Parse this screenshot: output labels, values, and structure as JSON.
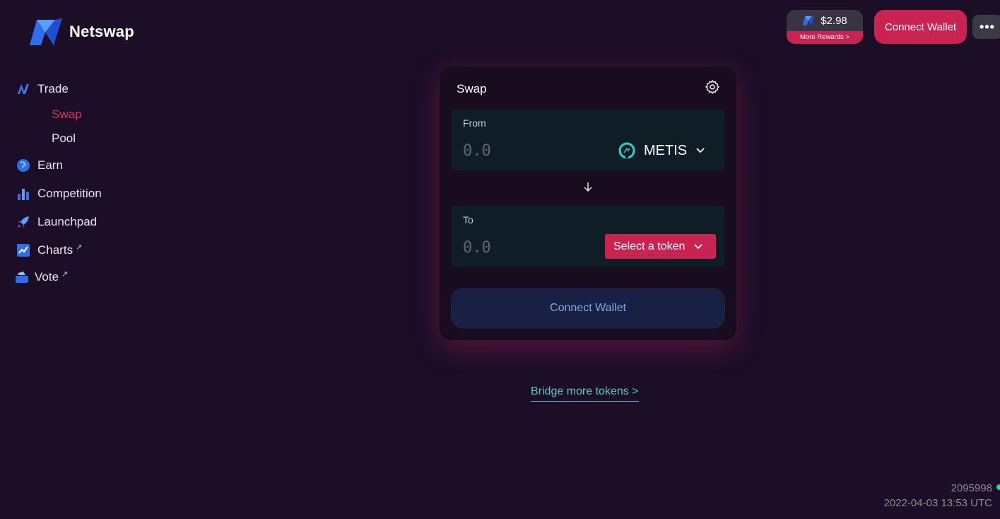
{
  "app": {
    "name": "Netswap"
  },
  "sidebar": {
    "trade": "Trade",
    "swap": "Swap",
    "pool": "Pool",
    "earn": "Earn",
    "competition": "Competition",
    "launchpad": "Launchpad",
    "charts": "Charts",
    "vote": "Vote",
    "external_mark": "↗"
  },
  "header": {
    "price": "$2.98",
    "rewards": "More Rewards >",
    "connect_wallet": "Connect Wallet",
    "more": "•••"
  },
  "swap": {
    "title": "Swap",
    "from_label": "From",
    "from_placeholder": "0.0",
    "from_token": "METIS",
    "to_label": "To",
    "to_placeholder": "0.0",
    "select_token": "Select a token",
    "connect_wallet": "Connect Wallet"
  },
  "bridge_link": "Bridge more tokens >",
  "footer": {
    "block_number": "2095998",
    "timestamp": "2022-04-03 13:53 UTC"
  },
  "colors": {
    "background": "#1b0e26",
    "accent": "#c92352",
    "link": "#5cc7c7",
    "panel": "#0f1d26"
  }
}
